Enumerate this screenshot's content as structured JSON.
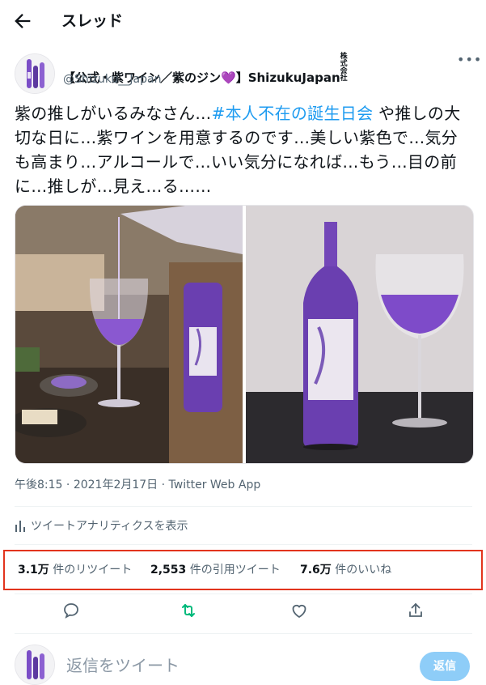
{
  "header": {
    "back_icon": "arrow-left-icon",
    "title": "スレッド"
  },
  "author": {
    "display_name": "【公式・紫ワイン／紫のジン",
    "heart": "💜",
    "display_name_suffix": "】ShizukuJapan",
    "badge_text": "株式会社",
    "handle": "@Shizuku__Japan",
    "more": "•••"
  },
  "tweet": {
    "text_before": "紫の推しがいるみなさん…",
    "hashtag": "#本人不在の誕生日会",
    "text_after": " や推しの大切な日に…紫ワインを用意するのです…美しい紫色で…気分も高まり…アルコールで…いい気分になれば…もう…目の前に…推しが…見え…る……"
  },
  "meta": {
    "time": "午後8:15",
    "separator1": " · ",
    "date": "2021年2月17日",
    "separator2": " · ",
    "source": "Twitter Web App"
  },
  "analytics": {
    "label": "ツイートアナリティクスを表示"
  },
  "stats": {
    "retweets_count": "3.1万",
    "retweets_label": " 件のリツイート",
    "quotes_count": "2,553",
    "quotes_label": " 件の引用ツイート",
    "likes_count": "7.6万",
    "likes_label": " 件のいいね"
  },
  "actions": [
    "reply-icon",
    "retweet-icon",
    "like-icon",
    "share-icon"
  ],
  "reply": {
    "placeholder": "返信をツイート",
    "button": "返信"
  },
  "colors": {
    "hashtag": "#1d9bf0",
    "retweet": "#00ba7c",
    "highlight": "#e2341d",
    "wine": "#6a3fb0",
    "reply_button": "#8ecdf8"
  }
}
